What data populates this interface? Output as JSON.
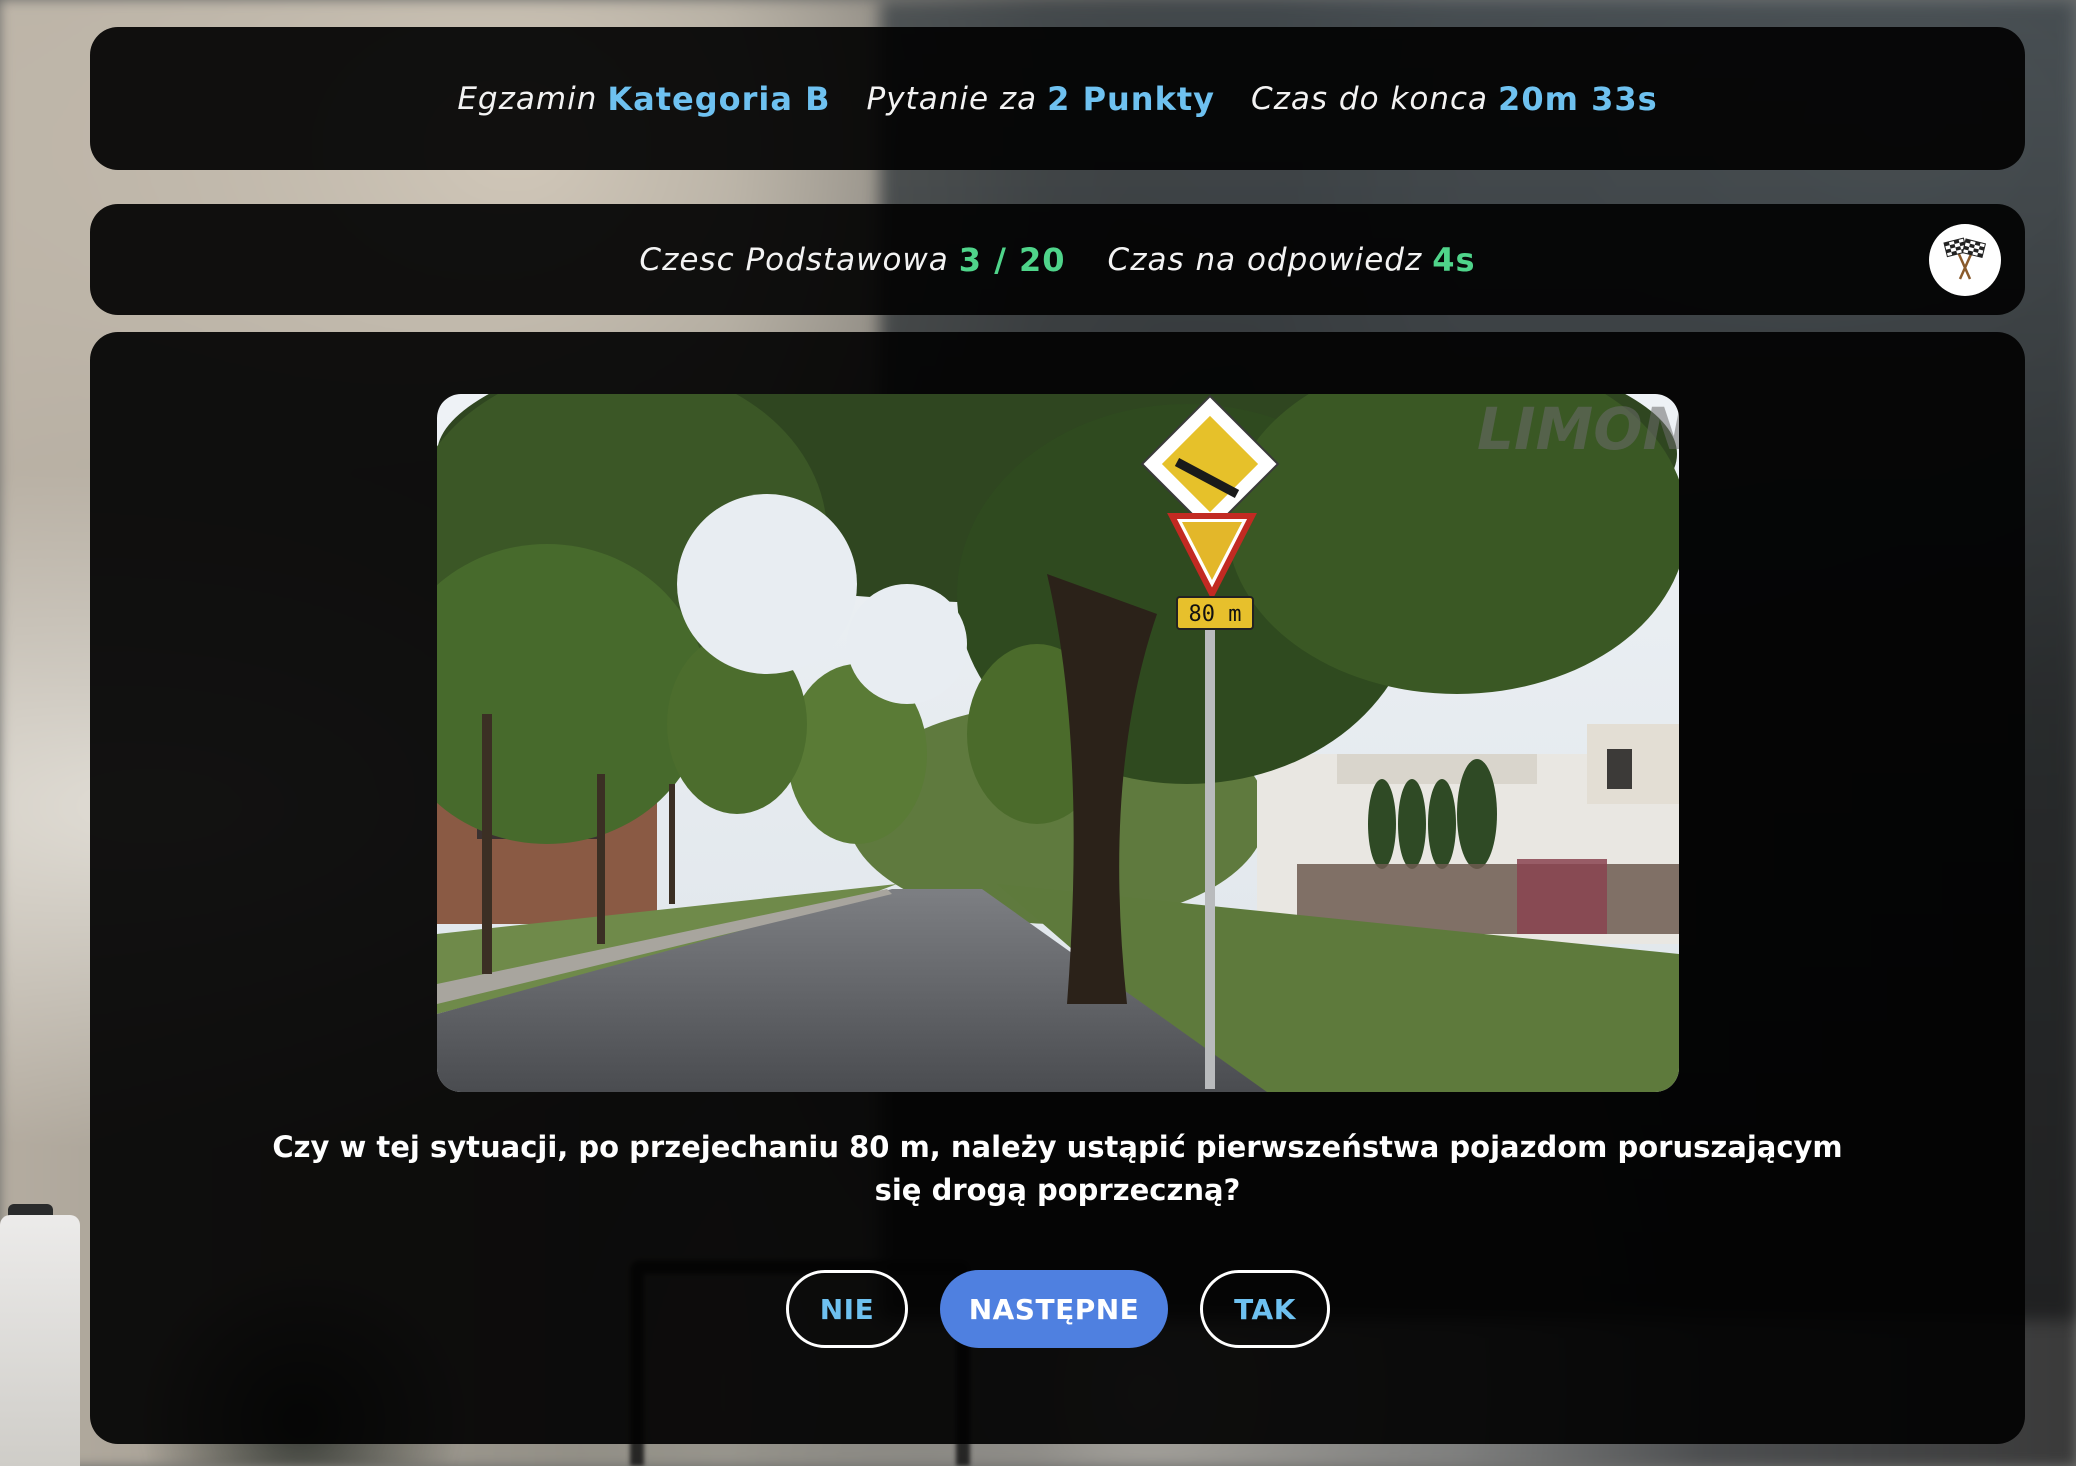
{
  "header": {
    "exam_label": "Egzamin",
    "exam_value": "Kategoria B",
    "question_label": "Pytanie za",
    "question_value": "2 Punkty",
    "time_label": "Czas do konca",
    "time_value": "20m 33s"
  },
  "progress": {
    "part_label": "Czesc Podstawowa",
    "part_value": "3 / 20",
    "answer_time_label": "Czas na odpowiedz",
    "answer_time_value": "4s",
    "flag_icon": "checkered-flags-icon"
  },
  "question": {
    "text": "Czy w tej sytuacji, po przejechaniu 80 m, należy ustąpić pierwszeństwa pojazdom poruszającym się drogą poprzeczną?",
    "image": {
      "watermark": "LIMONA",
      "sign_plate_text": "80 m"
    }
  },
  "answers": {
    "no_label": "NIE",
    "next_label": "NASTĘPNE",
    "yes_label": "TAK"
  },
  "colors": {
    "accent_blue": "#6ec1f0",
    "accent_green": "#4fd48a",
    "button_blue": "#4f80e0",
    "panel_bg": "#020202"
  }
}
